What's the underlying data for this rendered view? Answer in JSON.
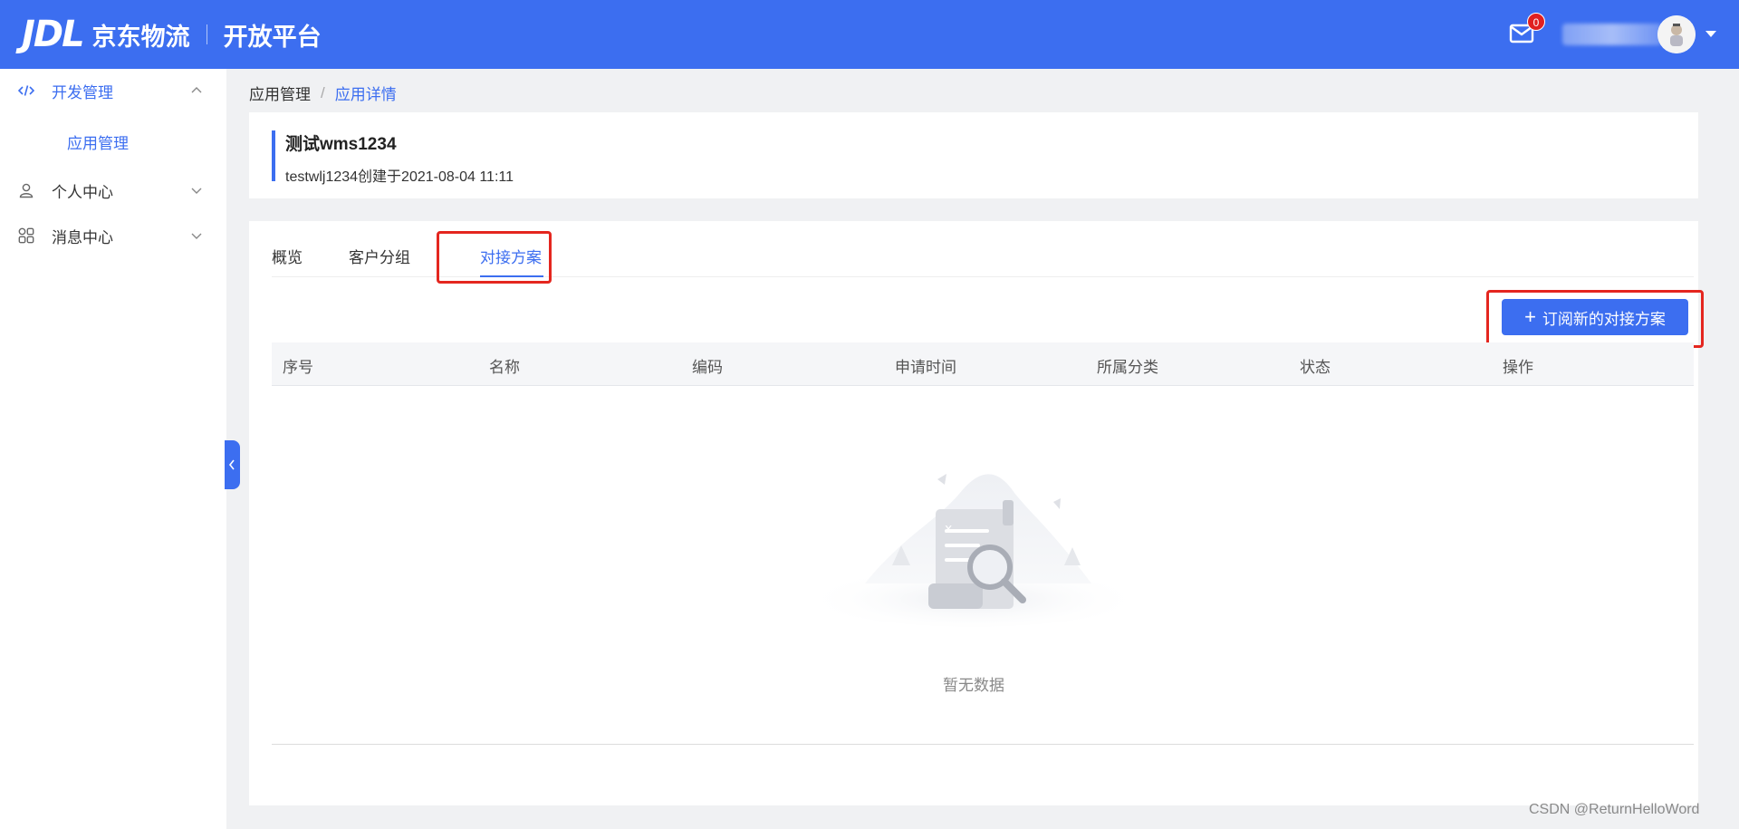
{
  "header": {
    "logo_jdl": "JDL",
    "logo_cn": "京东物流",
    "logo_sub": "开放平台",
    "mail_count": "0",
    "mail_icon": "mail-icon",
    "avatar_icon": "avatar",
    "brand_color": "#3c6ef0"
  },
  "sidebar": {
    "items": [
      {
        "label": "开发管理",
        "icon": "code-icon",
        "expanded": true,
        "active": true
      },
      {
        "label": "个人中心",
        "icon": "user-icon",
        "expanded": false
      },
      {
        "label": "消息中心",
        "icon": "grid-icon",
        "expanded": false
      }
    ],
    "submenu": [
      {
        "label": "应用管理",
        "active": true
      }
    ]
  },
  "breadcrumb": {
    "root": "应用管理",
    "separator": "/",
    "current": "应用详情"
  },
  "app_info": {
    "title": "测试wms1234",
    "meta": "testwlj1234创建于2021-08-04 11:11"
  },
  "tabs": [
    {
      "label": "概览"
    },
    {
      "label": "客户分组"
    },
    {
      "label": "对接方案",
      "active": true
    }
  ],
  "subscribe_button": {
    "plus": "+",
    "label": "订阅新的对接方案"
  },
  "table": {
    "columns": [
      "序号",
      "名称",
      "编码",
      "申请时间",
      "所属分类",
      "状态",
      "操作"
    ],
    "rows": [],
    "empty_text": "暂无数据"
  },
  "watermark": "CSDN @ReturnHelloWord"
}
